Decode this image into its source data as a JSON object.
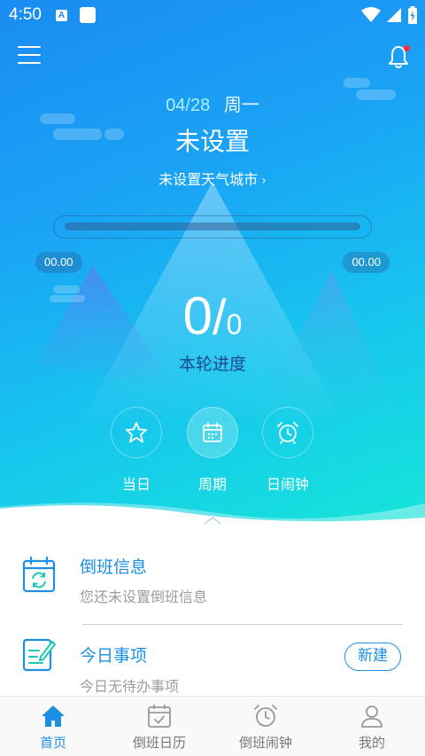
{
  "status_bar": {
    "time": "4:50",
    "notif_icon_letter": "A"
  },
  "header": {
    "date": "04/28",
    "weekday": "周一",
    "shift_name": "未设置",
    "weather_city": "未设置天气城市",
    "city_chevron": "›"
  },
  "progress": {
    "start_time": "00.00",
    "end_time": "00.00",
    "fraction": 0
  },
  "round": {
    "current": "0",
    "separator": "/",
    "total": "0",
    "label": "本轮进度"
  },
  "quick_actions": [
    {
      "label": "当日",
      "icon": "star-icon"
    },
    {
      "label": "周期",
      "icon": "calendar-icon"
    },
    {
      "label": "日闹钟",
      "icon": "alarm-clock-icon"
    }
  ],
  "shift_info": {
    "title": "倒班信息",
    "subtitle": "您还未设置倒班信息"
  },
  "today_items": {
    "title": "今日事项",
    "subtitle": "今日无待办事项",
    "new_button": "新建"
  },
  "bottom_nav": [
    {
      "label": "首页",
      "icon": "home-icon",
      "active": true
    },
    {
      "label": "倒班日历",
      "icon": "calendar-check-icon",
      "active": false
    },
    {
      "label": "倒班闹钟",
      "icon": "alarm-clock-icon",
      "active": false
    },
    {
      "label": "我的",
      "icon": "user-icon",
      "active": false
    }
  ],
  "colors": {
    "accent": "#1a8fe3",
    "gradient_start": "#1a8cf2",
    "gradient_end": "#16e6d8",
    "notification_dot": "#ff2d2d"
  }
}
